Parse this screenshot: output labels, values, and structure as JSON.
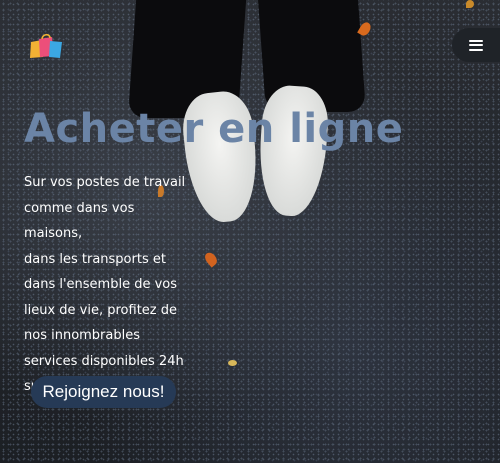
{
  "header": {
    "logo_icon": "shopping-bags-icon",
    "menu_icon": "hamburger-menu-icon"
  },
  "hero": {
    "title": "Acheter en ligne",
    "description_lines": [
      "Sur vos postes de travail",
      "comme dans vos maisons,",
      "dans les transports et",
      "dans l'ensemble de vos",
      "lieux de vie, profitez de",
      "nos innombrables",
      "services disponibles 24h",
      "sur 24."
    ],
    "cta_label": "Rejoignez nous!"
  },
  "colors": {
    "title": "#6b84a6",
    "cta_background": "#263a56",
    "menu_background": "#1f2328",
    "text": "#ffffff"
  }
}
